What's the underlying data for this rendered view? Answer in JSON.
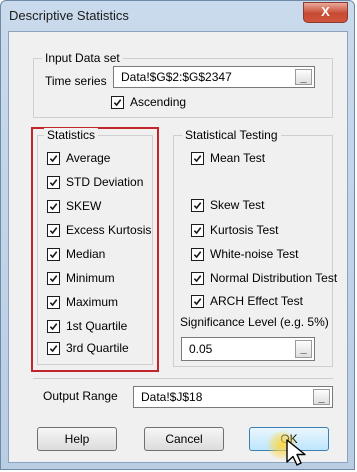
{
  "window": {
    "title": "Descriptive Statistics",
    "close_symbol": "X"
  },
  "input_data_set": {
    "group_label": "Input Data set",
    "time_series_label": "Time series",
    "time_series_value": "Data!$G$2:$G$2347",
    "browse_symbol": "_",
    "ascending_label": "Ascending",
    "ascending_checked": true
  },
  "statistics": {
    "group_label": "Statistics",
    "items": [
      {
        "label": "Average",
        "checked": true
      },
      {
        "label": "STD Deviation",
        "checked": true
      },
      {
        "label": "SKEW",
        "checked": true
      },
      {
        "label": "Excess Kurtosis",
        "checked": true
      },
      {
        "label": "Median",
        "checked": true
      },
      {
        "label": "Minimum",
        "checked": true
      },
      {
        "label": "Maximum",
        "checked": true
      },
      {
        "label": "1st Quartile",
        "checked": true
      },
      {
        "label": "3rd Quartile",
        "checked": true
      }
    ]
  },
  "statistical_testing": {
    "group_label": "Statistical Testing",
    "items": [
      {
        "label": "Mean Test",
        "checked": true
      },
      {
        "label": "Skew Test",
        "checked": true
      },
      {
        "label": "Kurtosis Test",
        "checked": true
      },
      {
        "label": "White-noise Test",
        "checked": true
      },
      {
        "label": "Normal Distribution Test",
        "checked": true
      },
      {
        "label": "ARCH Effect Test",
        "checked": true
      }
    ],
    "significance_label": "Significance Level (e.g. 5%)",
    "significance_value": "0.05",
    "browse_symbol": "_"
  },
  "output": {
    "label": "Output Range",
    "value": "Data!$J$18",
    "browse_symbol": "_"
  },
  "buttons": {
    "help": "Help",
    "cancel": "Cancel",
    "ok": "OK"
  },
  "colors": {
    "highlight": "#c0262b",
    "close_button": "#c74a33"
  }
}
